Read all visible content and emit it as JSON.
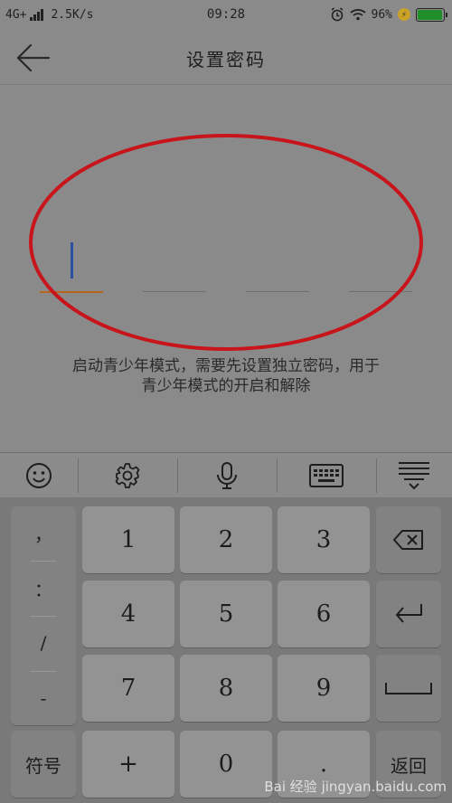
{
  "status_bar": {
    "network": "4G+",
    "speed": "2.5K/s",
    "time": "09:28",
    "battery": "96%",
    "battery_level": 0.96
  },
  "header": {
    "title": "设置密码",
    "back_icon": "arrow-left-icon"
  },
  "password": {
    "length": 4,
    "filled": 0
  },
  "hint": {
    "line1": "启动青少年模式，需要先设置独立密码，用于",
    "line2": "青少年模式的开启和解除"
  },
  "keyboard": {
    "toolbar_icons": [
      "emoji-icon",
      "gear-icon",
      "microphone-icon",
      "keyboard-icon",
      "hide-keyboard-icon"
    ],
    "punctuation": [
      "，",
      "：",
      "/",
      "-"
    ],
    "symbol_label": "符号",
    "keys": [
      "1",
      "2",
      "3",
      "4",
      "5",
      "6",
      "7",
      "8",
      "9",
      "+",
      "0",
      "."
    ],
    "return_label": "返回"
  },
  "annotation_color": "#c8141b",
  "watermark": "Bai 经验 jingyan.baidu.com"
}
